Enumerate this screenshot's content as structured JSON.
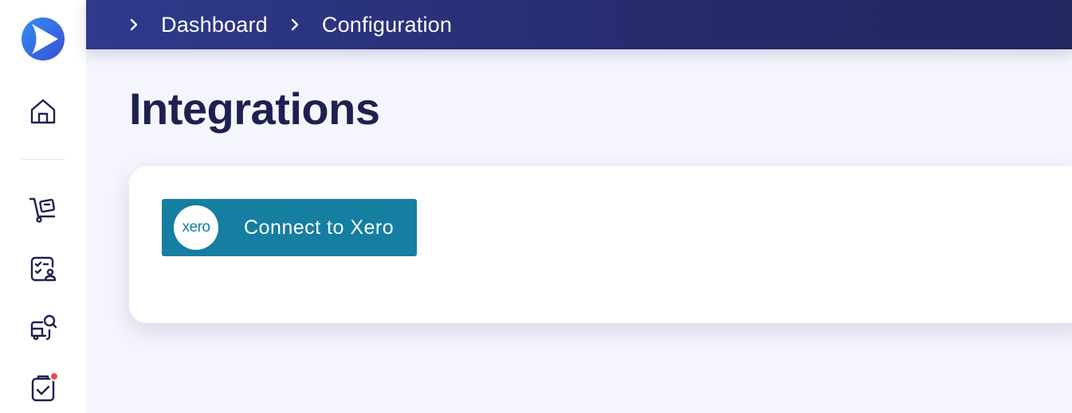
{
  "sidebar": {
    "logo": "app-logo",
    "items": [
      {
        "icon": "home-icon"
      },
      {
        "icon": "trolley-icon"
      },
      {
        "icon": "checklist-user-icon"
      },
      {
        "icon": "truck-search-icon"
      },
      {
        "icon": "clipboard-check-icon",
        "has_notification": true
      }
    ]
  },
  "breadcrumb": {
    "items": [
      "Dashboard",
      "Configuration"
    ]
  },
  "page": {
    "title": "Integrations"
  },
  "integrations": {
    "xero": {
      "logo_text": "xero",
      "label": "Connect to Xero"
    }
  },
  "colors": {
    "topbar": "#2e3a8c",
    "xero_button": "#157ea1",
    "title": "#1d2150",
    "notification": "#ef4456"
  }
}
